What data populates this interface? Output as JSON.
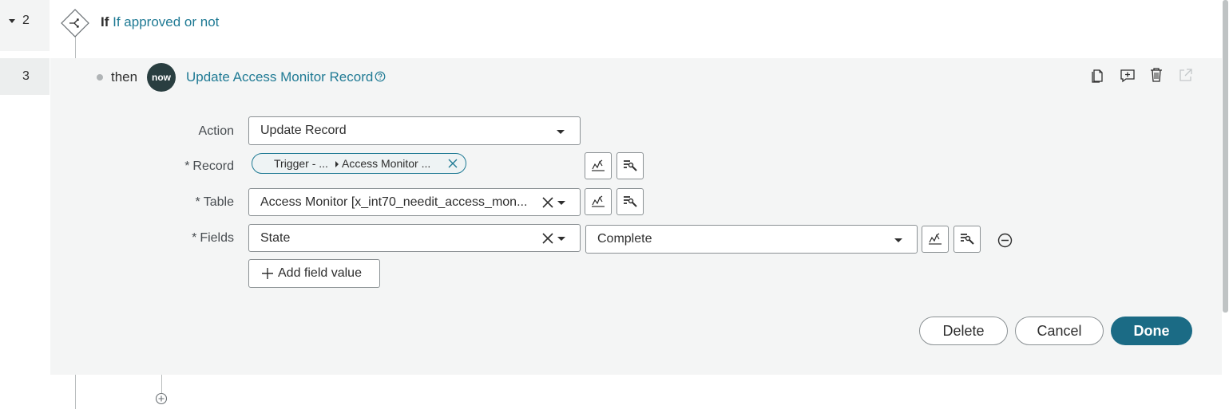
{
  "rows": [
    {
      "number": "2",
      "keyword": "If",
      "condition": "If approved or not"
    },
    {
      "number": "3",
      "keyword": "then",
      "badge": "now",
      "action_title": "Update Access Monitor Record"
    }
  ],
  "form": {
    "action": {
      "label": "Action",
      "value": "Update Record"
    },
    "record": {
      "label": "Record",
      "required": "*",
      "pill_part1": "Trigger - ...",
      "pill_part2": "Access Monitor ..."
    },
    "table": {
      "label": "Table",
      "required": "*",
      "value": "Access Monitor [x_int70_needit_access_mon..."
    },
    "fields": {
      "label": "Fields",
      "required": "*",
      "field_name": "State",
      "field_value": "Complete"
    },
    "add_field_label": "Add field value"
  },
  "buttons": {
    "delete": "Delete",
    "cancel": "Cancel",
    "done": "Done"
  },
  "colors": {
    "accent": "#1f7a94",
    "done_bg": "#1b6b85",
    "panel_bg": "#f4f5f5",
    "gutter_bg": "#f3f4f4"
  },
  "icons": [
    "collapse-caret-icon",
    "decision-diamond-icon",
    "help-circle-icon",
    "copy-icon",
    "add-comment-icon",
    "trash-icon",
    "open-external-icon",
    "data-pill-picker-icon",
    "record-picker-icon",
    "remove-circle-icon",
    "add-step-circle-icon"
  ]
}
